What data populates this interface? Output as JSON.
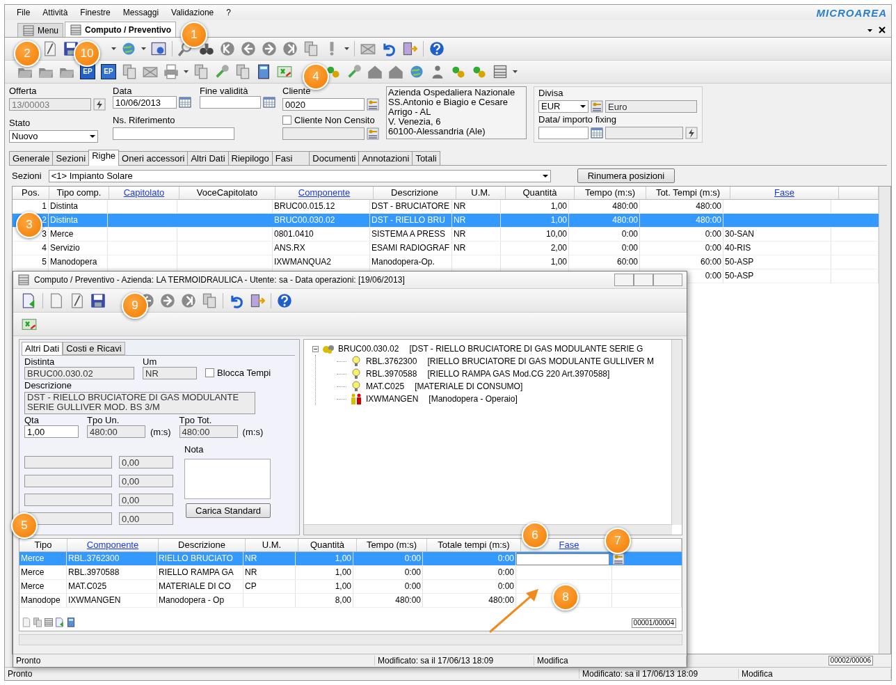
{
  "menu_bar": {
    "items": [
      "File",
      "Attività",
      "Finestre",
      "Messaggi",
      "Validazione",
      "?"
    ],
    "logo": "MICROAREA"
  },
  "document_tabs": [
    {
      "label": "Menu",
      "selected": false
    },
    {
      "label": "Computo / Preventivo",
      "selected": true
    }
  ],
  "toolbar_2_labels": [
    "EP",
    "EP"
  ],
  "form": {
    "offerta": {
      "label": "Offerta",
      "value": "13/00003",
      "disabled": true
    },
    "data": {
      "label": "Data",
      "value": "10/06/2013"
    },
    "fine_validita": {
      "label": "Fine validità"
    },
    "cliente": {
      "label": "Cliente",
      "value": "0020"
    },
    "stato": {
      "label": "Stato",
      "value": "Nuovo"
    },
    "ns_riferimento": {
      "label": "Ns. Riferimento"
    },
    "cliente_non_censito": {
      "label": "Cliente Non Censito",
      "checked": false
    },
    "address": [
      "Azienda Ospedaliera Nazionale",
      "SS.Antonio e Biagio e Cesare",
      "Arrigo - AL",
      "V. Venezia, 6",
      "60100-Alessandria (Ale)"
    ],
    "divisa": {
      "label": "Divisa",
      "value": "EUR",
      "description": "Euro"
    },
    "fixing": {
      "label": "Data/ importo fixing"
    }
  },
  "tabs": [
    {
      "label": "Generale",
      "selected": false
    },
    {
      "label": "Sezioni",
      "selected": false
    },
    {
      "label": "Righe",
      "selected": true
    },
    {
      "label": "Oneri accessori",
      "selected": false
    },
    {
      "label": "Altri Dati",
      "selected": false
    },
    {
      "label": "Riepilogo",
      "selected": false
    },
    {
      "label": "Fasi",
      "selected": false
    },
    {
      "label": "Documenti",
      "selected": false
    },
    {
      "label": "Annotazioni",
      "selected": false
    },
    {
      "label": "Totali",
      "selected": false
    }
  ],
  "sezioni": {
    "label": "Sezioni",
    "value": "<1> Impianto Solare",
    "button": "Rinumera posizioni"
  },
  "grid": {
    "columns": [
      {
        "label": "Pos.",
        "link": false
      },
      {
        "label": "Tipo comp.",
        "link": false
      },
      {
        "label": "Capitolato",
        "link": true
      },
      {
        "label": "VoceCapitolato",
        "link": false
      },
      {
        "label": "Componente",
        "link": true
      },
      {
        "label": "Descrizione",
        "link": false
      },
      {
        "label": "U.M.",
        "link": false
      },
      {
        "label": "Quantità",
        "link": false
      },
      {
        "label": "Tempo (m:s)",
        "link": false
      },
      {
        "label": "Tot. Tempi (m:s)",
        "link": false
      },
      {
        "label": "Fase",
        "link": true
      }
    ],
    "rows": [
      {
        "selected": false,
        "cells": [
          "1",
          "Distinta",
          "",
          "",
          "BRUC00.015.12",
          "DST - BRUCIATORE",
          "NR",
          "1,00",
          "480:00",
          "480:00",
          ""
        ]
      },
      {
        "selected": true,
        "cells": [
          "2",
          "Distinta",
          "",
          "",
          "BRUC00.030.02",
          "DST - RIELLO BRU",
          "NR",
          "1,00",
          "480:00",
          "480:00",
          ""
        ]
      },
      {
        "selected": false,
        "cells": [
          "3",
          "Merce",
          "",
          "",
          "0801.0410",
          "SISTEMA A PRESS",
          "NR",
          "10,00",
          "0:00",
          "0:00",
          "30-SAN"
        ]
      },
      {
        "selected": false,
        "cells": [
          "4",
          "Servizio",
          "",
          "",
          "ANS.RX",
          "ESAMI RADIOGRAF",
          "NR",
          "2,00",
          "0:00",
          "0:00",
          "40-RIS"
        ]
      },
      {
        "selected": false,
        "cells": [
          "5",
          "Manodopera",
          "",
          "",
          "IXWMANQUA2",
          "Manodopera-Op.",
          "",
          "1,00",
          "60:00",
          "60:00",
          "50-ASP"
        ]
      },
      {
        "selected": false,
        "cells": [
          "",
          "",
          "",
          "",
          "",
          "",
          "",
          "",
          "",
          "0:00",
          "50-ASP"
        ]
      }
    ],
    "pager": "00002/00006"
  },
  "status_bar": [
    "Pronto",
    "Modificato: sa il 17/06/13 18:09",
    "Modifica"
  ],
  "dialog": {
    "title": "Computo / Preventivo - Azienda: LA TERMOIDRAULICA - Utente: sa - Data operazioni: [19/06/2013]",
    "tabs": [
      {
        "label": "Altri Dati",
        "selected": true
      },
      {
        "label": "Costi e Ricavi",
        "selected": false
      }
    ],
    "distinta": {
      "label": "Distinta",
      "value": "BRUC00.030.02"
    },
    "um": {
      "label": "Um",
      "value": "NR"
    },
    "blocca_tempi": {
      "label": "Blocca Tempi",
      "checked": false
    },
    "descrizione": {
      "label": "Descrizione",
      "value": "DST - RIELLO BRUCIATORE DI GAS MODULANTE\nSERIE GULLIVER MOD. BS 3/M"
    },
    "qta": {
      "label": "Qta",
      "value": "1,00"
    },
    "tpo_un": {
      "label": "Tpo Un.",
      "value": "480:00",
      "unit": "(m:s)"
    },
    "tpo_tot": {
      "label": "Tpo Tot.",
      "value": "480:00",
      "unit": "(m:s)"
    },
    "amounts": [
      "0,00",
      "0,00",
      "0,00",
      "0,00"
    ],
    "nota": {
      "label": "Nota"
    },
    "carica_button": "Carica Standard",
    "tree": {
      "code": "BRUC00.030.02",
      "description": "[DST - RIELLO BRUCIATORE DI GAS MODULANTE SERIE G",
      "kind": "assembly",
      "expanded": true,
      "children": [
        {
          "code": "RBL.3762300",
          "description": "[RIELLO BRUCIATORE DI GAS MODULANTE GULLIVER M",
          "kind": "item"
        },
        {
          "code": "RBL.3970588",
          "description": "[RIELLO RAMPA GAS Mod.CG 220 Art.3970588]",
          "kind": "item"
        },
        {
          "code": "MAT.C025",
          "description": "[MATERIALE DI CONSUMO]",
          "kind": "item"
        },
        {
          "code": "IXWMANGEN",
          "description": "[Manodopera - Operaio]",
          "kind": "labor"
        }
      ]
    },
    "grid": {
      "columns": [
        {
          "label": "Tipo",
          "link": false
        },
        {
          "label": "Componente",
          "link": true
        },
        {
          "label": "Descrizione",
          "link": false
        },
        {
          "label": "U.M.",
          "link": false
        },
        {
          "label": "Quantità",
          "link": false
        },
        {
          "label": "Tempo (m:s)",
          "link": false
        },
        {
          "label": "Totale tempi (m:s)",
          "link": false
        },
        {
          "label": "Fase",
          "link": true
        }
      ],
      "rows": [
        {
          "selected": true,
          "cells": [
            "Merce",
            "RBL.3762300",
            "RIELLO BRUCIATO",
            "NR",
            "1,00",
            "0:00",
            "0:00",
            ""
          ]
        },
        {
          "selected": false,
          "cells": [
            "Merce",
            "RBL.3970588",
            "RIELLO RAMPA GA",
            "NR",
            "1,00",
            "0:00",
            "0:00",
            ""
          ]
        },
        {
          "selected": false,
          "cells": [
            "Merce",
            "MAT.C025",
            "MATERIALE DI CO",
            "CP",
            "1,00",
            "0:00",
            "0:00",
            ""
          ]
        },
        {
          "selected": false,
          "cells": [
            "Manodope",
            "IXWMANGEN",
            "Manodopera - Op",
            "",
            "8,00",
            "480:00",
            "480:00",
            ""
          ]
        }
      ],
      "pager": "00001/00004"
    },
    "status_bar": [
      "Pronto",
      "Modificato: sa il 17/06/13 18:09",
      "Modifica"
    ]
  },
  "callouts": [
    "1",
    "2",
    "10",
    "4",
    "3",
    "9",
    "5",
    "6",
    "7",
    "8"
  ]
}
